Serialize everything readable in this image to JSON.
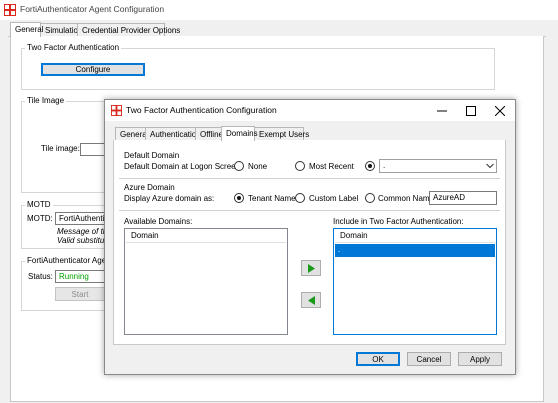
{
  "main_window": {
    "title": "FortiAuthenticator Agent Configuration",
    "tabs": [
      "General",
      "Simulation",
      "Credential Provider Options"
    ],
    "two_factor_group": {
      "title": "Two Factor Authentication",
      "configure_label": "Configure"
    },
    "tile_group": {
      "title": "Tile Image",
      "tile_label": "Tile image:"
    },
    "motd_group": {
      "title": "MOTD",
      "motd_label": "MOTD:",
      "motd_value": "FortiAuthenticat",
      "hint_line1": "Message of the",
      "hint_line2": "Valid substituti"
    },
    "agent_status_group": {
      "title": "FortiAuthenticator Agent S",
      "status_label": "Status:",
      "status_value": "Running",
      "status_color": "#00a000",
      "start_label": "Start"
    }
  },
  "dialog": {
    "title": "Two Factor Authentication Configuration",
    "tabs": [
      "General",
      "Authentication",
      "Offline",
      "Domains",
      "Exempt Users"
    ],
    "active_tab": "Domains",
    "default_domain": {
      "title": "Default Domain",
      "label": "Default Domain at Logon Screen:",
      "option_none": "None",
      "option_most_recent": "Most Recent",
      "selected_value": "."
    },
    "azure_domain": {
      "title": "Azure Domain",
      "label": "Display Azure domain as:",
      "option_tenant": "Tenant Name",
      "option_custom": "Custom Label",
      "option_common": "Common Name:",
      "common_name_value": "AzureAD"
    },
    "available_domains": {
      "label": "Available Domains:",
      "column": "Domain",
      "rows": []
    },
    "include_domains": {
      "label": "Include in Two Factor Authentication:",
      "column": "Domain",
      "rows": [
        "."
      ]
    },
    "buttons": {
      "ok": "OK",
      "cancel": "Cancel",
      "apply": "Apply"
    }
  },
  "colors": {
    "accent": "#0078d7",
    "arrow_green": "#1a9a1a",
    "brand_red": "#da291c"
  }
}
